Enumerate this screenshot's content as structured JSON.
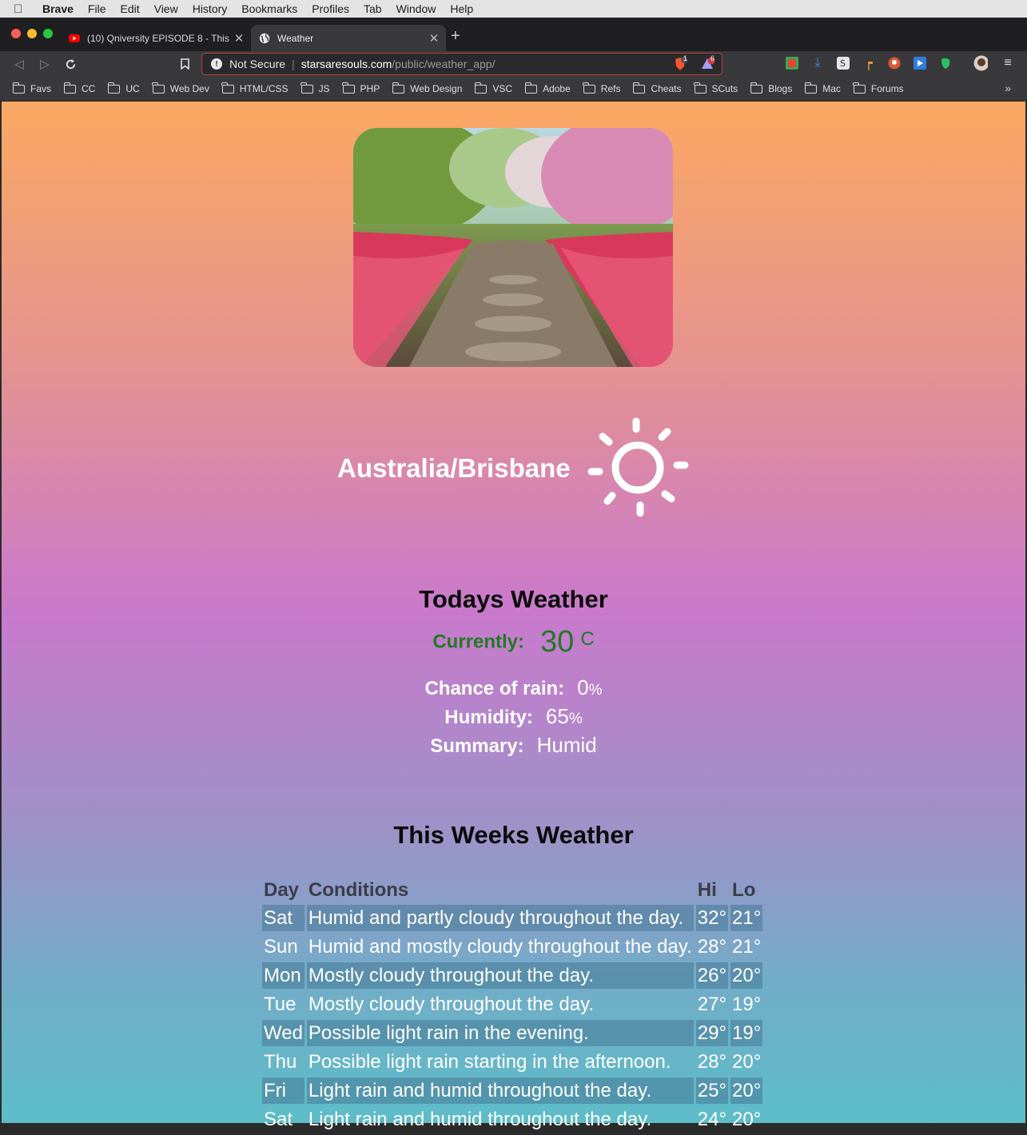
{
  "menubar": {
    "app": "Brave",
    "items": [
      "File",
      "Edit",
      "View",
      "History",
      "Bookmarks",
      "Profiles",
      "Tab",
      "Window",
      "Help"
    ]
  },
  "tabs": [
    {
      "title": "(10) Qniversity EPISODE 8 - This",
      "icon": "youtube-icon",
      "active": false
    },
    {
      "title": "Weather",
      "icon": "globe-icon",
      "active": true
    }
  ],
  "address_bar": {
    "security_label": "Not Secure",
    "host": "starsaresouls.com",
    "path": "/public/weather_app/",
    "brave_shield_count": "1",
    "rewards_count": "6"
  },
  "bookmarks": [
    "Favs",
    "CC",
    "UC",
    "Web Dev",
    "HTML/CSS",
    "JS",
    "PHP",
    "Web Design",
    "VSC",
    "Adobe",
    "Refs",
    "Cheats",
    "SCuts",
    "Blogs",
    "Mac",
    "Forums"
  ],
  "bookmarks_more": "»",
  "location": "Australia/Brisbane",
  "weather_icon": "sun-icon",
  "today": {
    "heading": "Todays Weather",
    "currently_label": "Currently:",
    "currently_value": "30",
    "currently_unit": "C",
    "rain_label": "Chance of rain:",
    "rain_value": "0",
    "humidity_label": "Humidity:",
    "humidity_value": "65",
    "percent_sign": "%",
    "summary_label": "Summary:",
    "summary_value": "Humid"
  },
  "week": {
    "heading": "This Weeks Weather",
    "columns": [
      "Day",
      "Conditions",
      "Hi",
      "Lo"
    ],
    "rows": [
      {
        "day": "Sat",
        "conditions": "Humid and partly cloudy throughout the day.",
        "hi": "32°",
        "lo": "21°"
      },
      {
        "day": "Sun",
        "conditions": "Humid and mostly cloudy throughout the day.",
        "hi": "28°",
        "lo": "21°"
      },
      {
        "day": "Mon",
        "conditions": "Mostly cloudy throughout the day.",
        "hi": "26°",
        "lo": "20°"
      },
      {
        "day": "Tue",
        "conditions": "Mostly cloudy throughout the day.",
        "hi": "27°",
        "lo": "19°"
      },
      {
        "day": "Wed",
        "conditions": "Possible light rain in the evening.",
        "hi": "29°",
        "lo": "19°"
      },
      {
        "day": "Thu",
        "conditions": "Possible light rain starting in the afternoon.",
        "hi": "28°",
        "lo": "20°"
      },
      {
        "day": "Fri",
        "conditions": "Light rain and humid throughout the day.",
        "hi": "25°",
        "lo": "20°"
      },
      {
        "day": "Sat",
        "conditions": "Light rain and humid throughout the day.",
        "hi": "24°",
        "lo": "20°"
      }
    ]
  }
}
